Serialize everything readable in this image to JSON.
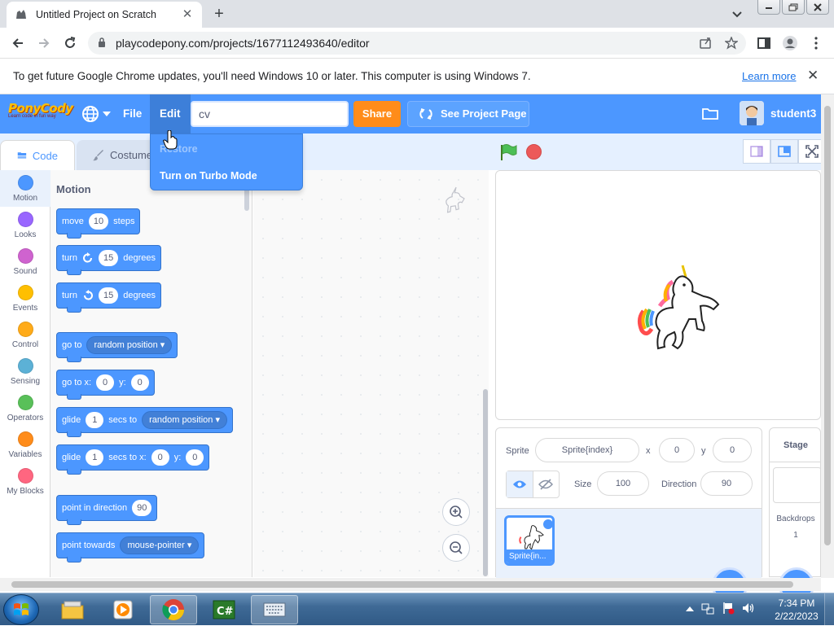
{
  "browser": {
    "tab_title": "Untitled Project on Scratch",
    "url": "playcodepony.com/projects/1677112493640/editor"
  },
  "infobar": {
    "message": "To get future Google Chrome updates, you'll need Windows 10 or later. This computer is using Windows 7.",
    "link": "Learn more"
  },
  "menubar": {
    "logo_text": "PonyCody",
    "logo_tagline": "Learn code in fun way",
    "file": "File",
    "edit": "Edit",
    "title_value": "cv",
    "share": "Share",
    "see_project": "See Project Page",
    "username": "student3"
  },
  "edit_menu": {
    "restore": "Restore",
    "turbo": "Turn on Turbo Mode"
  },
  "tabs": {
    "code": "Code",
    "costumes": "Costumes"
  },
  "categories": [
    {
      "label": "Motion",
      "color": "#4c97ff"
    },
    {
      "label": "Looks",
      "color": "#9966ff"
    },
    {
      "label": "Sound",
      "color": "#cf63cf"
    },
    {
      "label": "Events",
      "color": "#ffbf00"
    },
    {
      "label": "Control",
      "color": "#ffab19"
    },
    {
      "label": "Sensing",
      "color": "#5cb1d6"
    },
    {
      "label": "Operators",
      "color": "#59c059"
    },
    {
      "label": "Variables",
      "color": "#ff8c1a"
    },
    {
      "label": "My Blocks",
      "color": "#ff6680"
    }
  ],
  "palette": {
    "title": "Motion",
    "move": {
      "pre": "move",
      "val": "10",
      "post": "steps"
    },
    "turn_right": {
      "pre": "turn",
      "val": "15",
      "post": "degrees"
    },
    "turn_left": {
      "pre": "turn",
      "val": "15",
      "post": "degrees"
    },
    "goto": {
      "pre": "go to",
      "drop": "random position"
    },
    "goto_xy": {
      "pre": "go to x:",
      "x": "0",
      "ylabel": "y:",
      "y": "0"
    },
    "glide_to": {
      "pre": "glide",
      "secs": "1",
      "mid": "secs to",
      "drop": "random position"
    },
    "glide_xy": {
      "pre": "glide",
      "secs": "1",
      "mid": "secs to x:",
      "x": "0",
      "ylabel": "y:",
      "y": "0"
    },
    "point_dir": {
      "pre": "point in direction",
      "val": "90"
    },
    "point_towards": {
      "pre": "point towards",
      "drop": "mouse-pointer"
    }
  },
  "sprite_info": {
    "sprite_label": "Sprite",
    "sprite_name": "Sprite{index}",
    "x_label": "x",
    "x": "0",
    "y_label": "y",
    "y": "0",
    "size_label": "Size",
    "size": "100",
    "direction_label": "Direction",
    "direction": "90",
    "thumb_caption": "Sprite{in..."
  },
  "stage_pane": {
    "header": "Stage",
    "backdrops_label": "Backdrops",
    "backdrops_count": "1"
  },
  "taskbar": {
    "time": "7:34 PM",
    "date": "2/22/2023"
  }
}
